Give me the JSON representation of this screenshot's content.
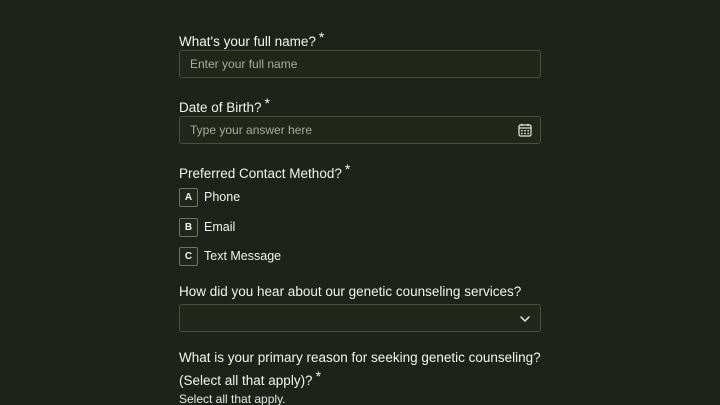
{
  "questions": {
    "name": {
      "label": "What's your full name?",
      "required_mark": "*",
      "placeholder": "Enter your full name"
    },
    "dob": {
      "label": "Date of Birth?",
      "required_mark": "*",
      "placeholder": "Type your answer here",
      "icon": "calendar-icon"
    },
    "contact": {
      "label": "Preferred Contact Method?",
      "required_mark": "*",
      "options": [
        {
          "key": "A",
          "label": "Phone"
        },
        {
          "key": "B",
          "label": "Email"
        },
        {
          "key": "C",
          "label": "Text Message"
        }
      ]
    },
    "referral": {
      "label": "How did you hear about our genetic counseling services?",
      "selected": "",
      "icon": "chevron-down-icon"
    },
    "reason": {
      "label_line1": "What is your primary reason for seeking genetic counseling?",
      "label_line2": "(Select all that apply)?",
      "required_mark": "*",
      "hint": "Select all that apply."
    }
  },
  "colors": {
    "background": "#1f2218",
    "field_border": "#4a4e3f",
    "text": "#f2f3ec",
    "placeholder": "#a9ad9c"
  }
}
